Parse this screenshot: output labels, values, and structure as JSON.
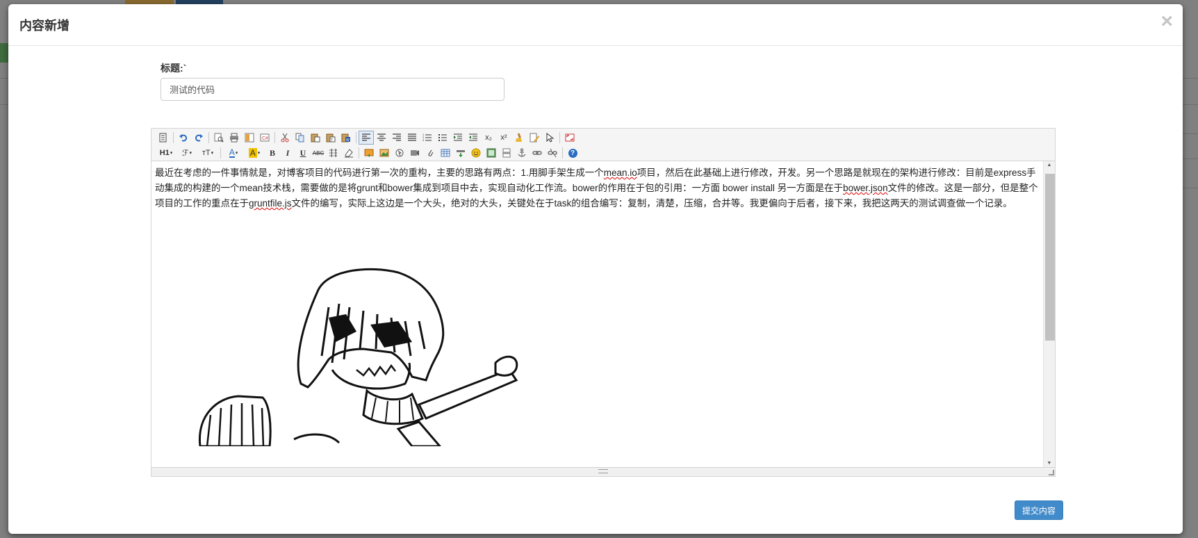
{
  "modal": {
    "title": "内容新增",
    "close_symbol": "×"
  },
  "form": {
    "title_label": "标题:`",
    "title_value": "测试的代码"
  },
  "editor": {
    "toolbar_row1": [
      "source-icon",
      "undo-icon",
      "redo-icon",
      "preview-icon",
      "print-icon",
      "template-icon",
      "code-icon",
      "cut-icon",
      "copy-icon",
      "paste-icon",
      "paste-plain-icon",
      "paste-word-icon",
      "align-left-icon",
      "align-center-icon",
      "align-right-icon",
      "justify-icon",
      "ordered-list-icon",
      "unordered-list-icon",
      "indent-icon",
      "outdent-icon",
      "subscript-icon",
      "superscript-icon",
      "clear-format-icon",
      "quick-format-icon",
      "select-all-icon",
      "fullscreen-icon"
    ],
    "toolbar_row2": [
      "heading-dropdown",
      "font-family-dropdown",
      "font-size-dropdown",
      "font-color-dropdown",
      "highlight-color-dropdown",
      "bold-icon",
      "italic-icon",
      "underline-icon",
      "strikethrough-icon",
      "line-height-icon",
      "remove-format-icon",
      "image-icon",
      "multi-image-icon",
      "flash-icon",
      "media-icon",
      "attachment-icon",
      "table-icon",
      "insert-code-icon",
      "emoticon-icon",
      "baidu-map-icon",
      "page-break-icon",
      "anchor-icon",
      "link-icon",
      "unlink-icon",
      "about-icon"
    ],
    "tb_text": {
      "subscript": "x₂",
      "superscript": "x²",
      "heading": "H1",
      "font_family": "ℱ",
      "font_size": "ᴛT",
      "font_color": "A",
      "highlight": "A",
      "bold": "B",
      "italic": "I",
      "underline": "U",
      "strike": "ABC",
      "about": "?"
    },
    "content_parts": [
      {
        "t": "最近在考虑的一件事情就是，对博客项目的代码进行第一次的重构，主要的思路有两点：1.用脚手架生成一个"
      },
      {
        "t": "mean.io",
        "spell": true
      },
      {
        "t": "项目，然后在此基础上进行修改，开发。另一个思路是就现在的架构进行修改：目前是express手动集成的构建的一个mean技术栈，需要做的是将grunt和bower集成到项目中去，实现自动化工作流。bower的作用在于包的引用：一方面 bower install 另一方面是在于"
      },
      {
        "t": "bower.json",
        "spell": true
      },
      {
        "t": "文件的修改。这是一部分，但是整个项目的工作的重点在于"
      },
      {
        "t": "gruntfile.js",
        "spell": true
      },
      {
        "t": "文件的编写，实际上这边是一个大头，绝对的大头，关键处在于task的组合编写：复制，清楚，压缩，合并等。我更偏向于后者，接下来，我把这两天的测试调查做一个记录。"
      }
    ]
  },
  "actions": {
    "submit_label": "提交内容"
  },
  "colors": {
    "primary": "#428bca",
    "spell_underline": "#dd0000"
  }
}
